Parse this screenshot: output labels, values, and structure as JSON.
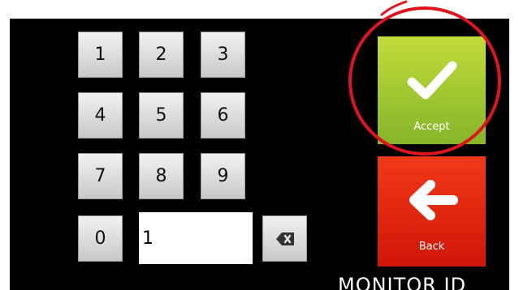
{
  "keypad": {
    "keys": [
      "1",
      "2",
      "3",
      "4",
      "5",
      "6",
      "7",
      "8",
      "9",
      "0"
    ],
    "entry_value": "1"
  },
  "actions": {
    "accept_label": "Accept",
    "back_label": "Back"
  },
  "screen_title": "MONITOR ID",
  "icons": {
    "backspace": "backspace-icon",
    "accept": "checkmark-icon",
    "back": "arrow-left-icon"
  },
  "colors": {
    "accept": "#8fbf2a",
    "back": "#e82a12",
    "highlight": "#e0141e"
  }
}
